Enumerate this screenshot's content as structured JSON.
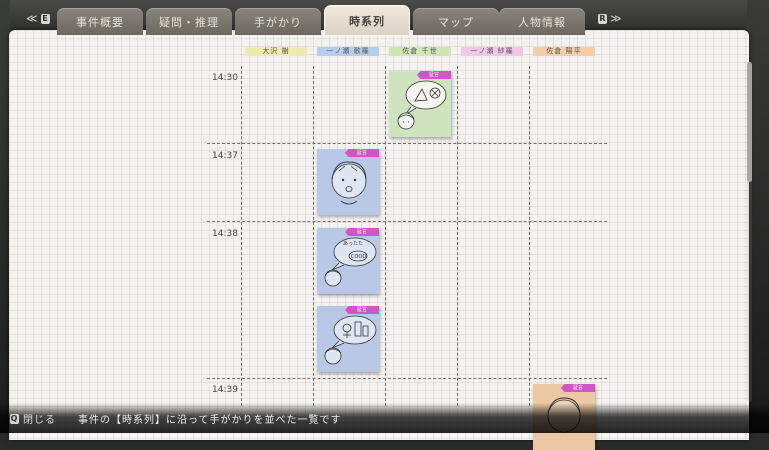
{
  "nav": {
    "prev_arrows": "≪",
    "prev_key": "E",
    "next_key": "R",
    "next_arrows": "≫"
  },
  "tabs": [
    {
      "label": "事件概要",
      "active": false
    },
    {
      "label": "疑問・推理",
      "active": false
    },
    {
      "label": "手がかり",
      "active": false
    },
    {
      "label": "時系列",
      "active": true
    },
    {
      "label": "マップ",
      "active": false
    },
    {
      "label": "人物情報",
      "active": false
    }
  ],
  "columns": [
    {
      "label": "大沢 樹",
      "color": "#ecebb0"
    },
    {
      "label": "一ノ瀬 歌羅",
      "color": "#b6cdee"
    },
    {
      "label": "佐倉 千世",
      "color": "#cfe6b8"
    },
    {
      "label": "一ノ瀬 紗羅",
      "color": "#f2c6e6"
    },
    {
      "label": "佐倉 陽平",
      "color": "#f2cfa8"
    }
  ],
  "times": [
    "14:30",
    "14:37",
    "14:38",
    "14:39"
  ],
  "note_tag": "証言",
  "notes": [
    {
      "column": "佐倉 千世",
      "time": "14:30",
      "color": "green"
    },
    {
      "column": "一ノ瀬 歌羅",
      "time": "14:37",
      "color": "blue"
    },
    {
      "column": "一ノ瀬 歌羅",
      "time": "14:38",
      "color": "blue",
      "bubble_text": "あったた"
    },
    {
      "column": "一ノ瀬 歌羅",
      "time": "14:38",
      "color": "blue"
    },
    {
      "column": "佐倉 陽平",
      "time": "14:39",
      "color": "peach"
    }
  ],
  "footer": {
    "close_key": "Q",
    "close_label": "閉じる",
    "description": "事件の【時系列】に沿って手がかりを並べた一覧です"
  }
}
